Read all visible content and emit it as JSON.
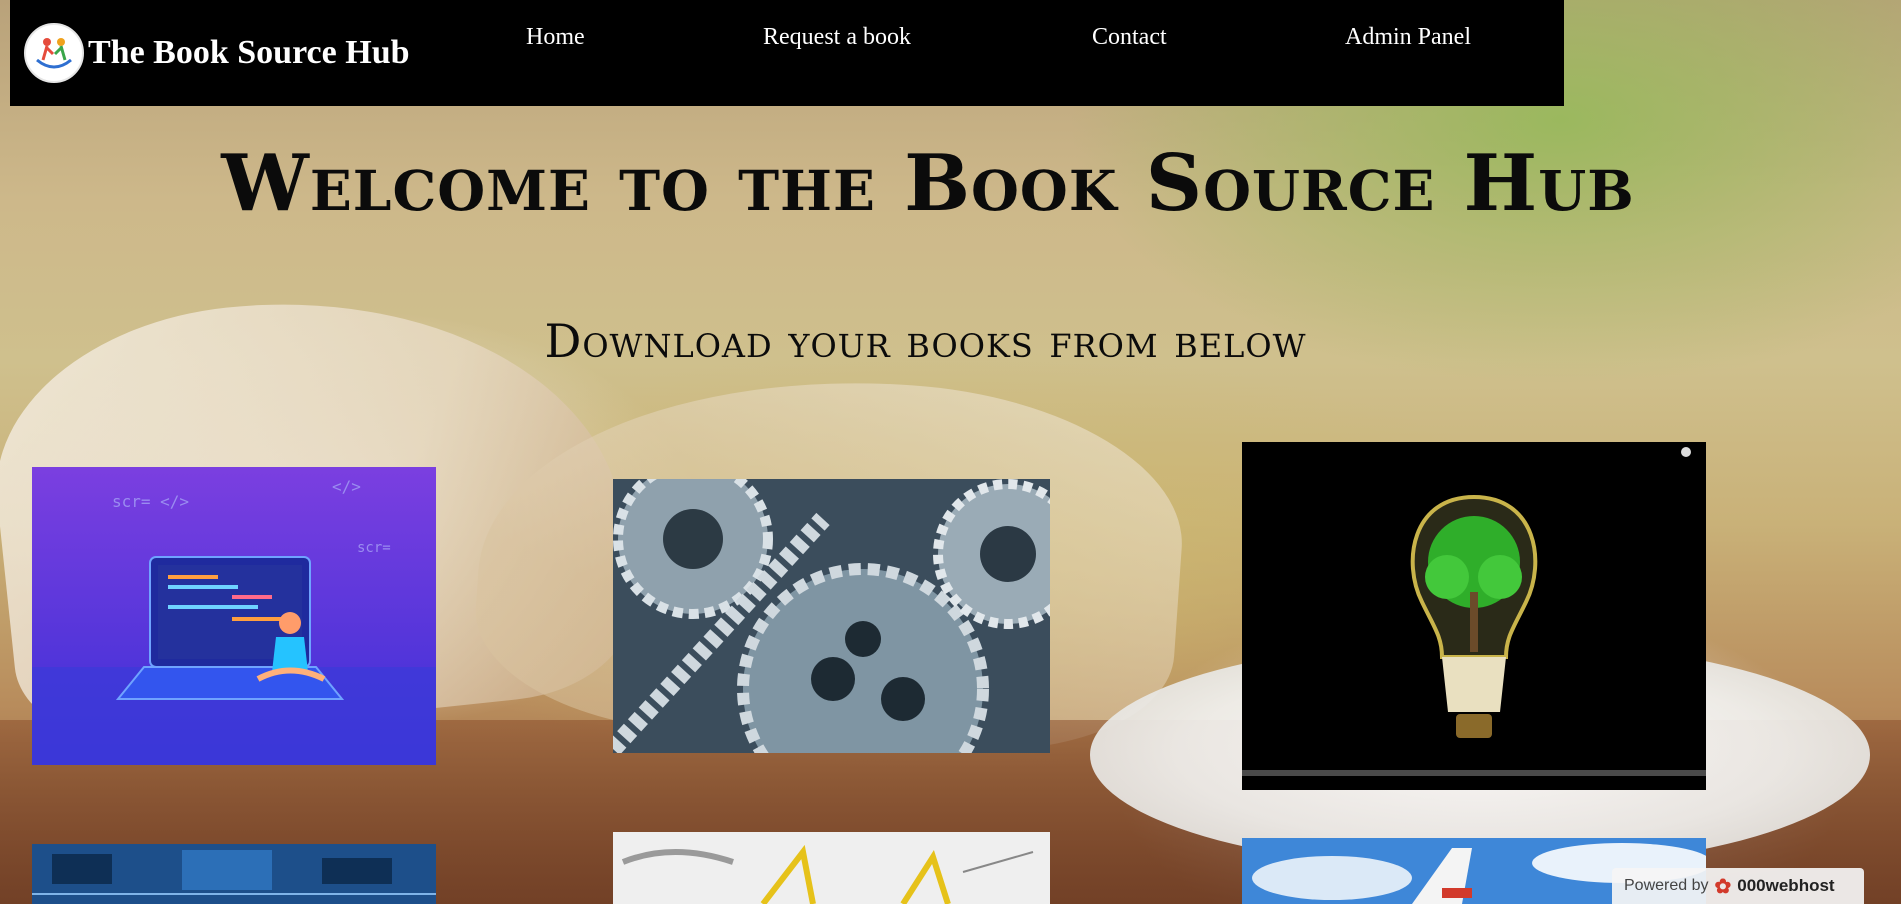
{
  "brand": {
    "title": "The Book Source Hub"
  },
  "nav": {
    "home": "Home",
    "request": "Request a book",
    "contact": "Contact",
    "admin": "Admin Panel"
  },
  "hero": {
    "title": "Welcome to the Book Source Hub",
    "subtitle": "Download your books from below"
  },
  "books": [
    {
      "id": "coding",
      "image": "programmer-laptop-illustration"
    },
    {
      "id": "mechanical",
      "image": "metal-gears"
    },
    {
      "id": "environment",
      "image": "tree-in-lightbulb"
    },
    {
      "id": "electronics",
      "image": "circuit-board"
    },
    {
      "id": "civil",
      "image": "blueprint-construction"
    },
    {
      "id": "aerospace",
      "image": "aircraft-sky"
    }
  ],
  "footer_badge": {
    "prefix": "Powered by",
    "host": "000webhost"
  },
  "colors": {
    "navbar": "#000000",
    "text": "#0b0b0b",
    "nav_text": "#ffffff"
  }
}
